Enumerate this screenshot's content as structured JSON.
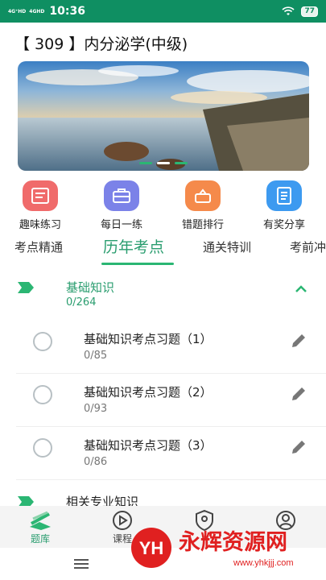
{
  "status_bar": {
    "network1": "4G⁺HD",
    "network2": "4GHD",
    "time": "10:36",
    "battery": "77"
  },
  "page_title": "【 309 】内分泌学(中级)",
  "quick_actions": [
    {
      "label": "趣味练习",
      "color": "#f06b6b",
      "icon": "list-icon"
    },
    {
      "label": "每日一练",
      "color": "#7b82e8",
      "icon": "briefcase-icon"
    },
    {
      "label": "错题排行",
      "color": "#f58a4b",
      "icon": "ranking-icon"
    },
    {
      "label": "有奖分享",
      "color": "#3d9af0",
      "icon": "notebook-icon"
    }
  ],
  "tabs": [
    "考点精通",
    "历年考点",
    "通关特训",
    "考前冲"
  ],
  "sections": [
    {
      "title": "基础知识",
      "count": "0/264",
      "items": [
        {
          "title": "基础知识考点习题（1）",
          "count": "0/85"
        },
        {
          "title": "基础知识考点习题（2）",
          "count": "0/93"
        },
        {
          "title": "基础知识考点习题（3）",
          "count": "0/86"
        }
      ]
    },
    {
      "title": "相关专业知识"
    }
  ],
  "bottom_nav": [
    "题库",
    "课程",
    "",
    ""
  ],
  "watermark": {
    "logo": "YH",
    "text": "永辉资源网",
    "url": "www.yhkjjj.com"
  },
  "colors": {
    "accent": "#2bb673",
    "status_bar": "#0f8f62"
  }
}
